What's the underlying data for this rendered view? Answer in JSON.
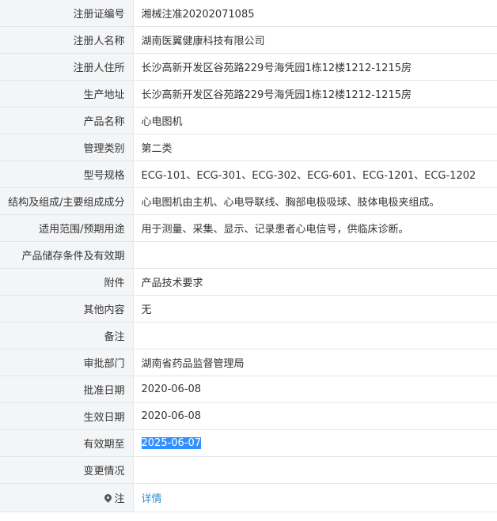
{
  "rows": [
    {
      "label": "注册证编号",
      "value": "湘械注准20202071085"
    },
    {
      "label": "注册人名称",
      "value": "湖南医翼健康科技有限公司"
    },
    {
      "label": "注册人住所",
      "value": "长沙高新开发区谷苑路229号海凭园1栋12楼1212-1215房"
    },
    {
      "label": "生产地址",
      "value": "长沙高新开发区谷苑路229号海凭园1栋12楼1212-1215房"
    },
    {
      "label": "产品名称",
      "value": "心电图机"
    },
    {
      "label": "管理类别",
      "value": "第二类"
    },
    {
      "label": "型号规格",
      "value": "ECG-101、ECG-301、ECG-302、ECG-601、ECG-1201、ECG-1202"
    },
    {
      "label": "结构及组成/主要组成成分",
      "value": "心电图机由主机、心电导联线、胸部电极吸球、肢体电极夹组成。"
    },
    {
      "label": "适用范围/预期用途",
      "value": "用于测量、采集、显示、记录患者心电信号，供临床诊断。"
    },
    {
      "label": "产品储存条件及有效期",
      "value": ""
    },
    {
      "label": "附件",
      "value": "产品技术要求"
    },
    {
      "label": "其他内容",
      "value": "无"
    },
    {
      "label": "备注",
      "value": ""
    },
    {
      "label": "审批部门",
      "value": "湖南省药品监督管理局"
    },
    {
      "label": "批准日期",
      "value": "2020-06-08"
    },
    {
      "label": "生效日期",
      "value": "2020-06-08"
    },
    {
      "label": "有效期至",
      "value": "2025-06-07"
    },
    {
      "label": "变更情况",
      "value": ""
    }
  ],
  "note": {
    "label": "注",
    "icon": "pin-icon",
    "link": "详情"
  }
}
